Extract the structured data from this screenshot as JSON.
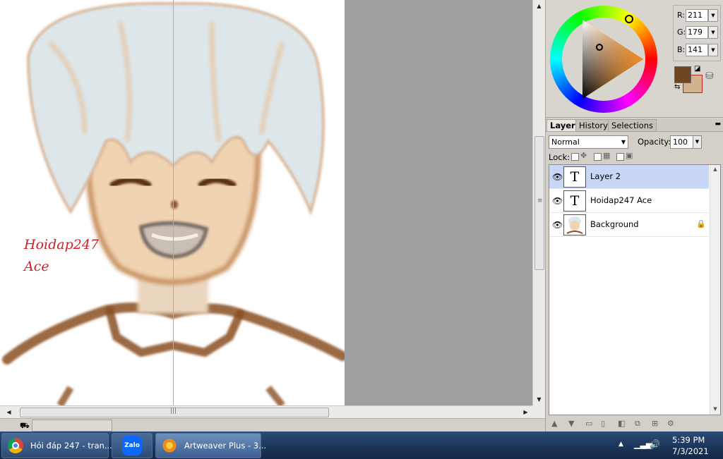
{
  "canvas": {
    "signature_line1": "Hoidap247",
    "signature_line2": "Ace"
  },
  "scrollbars": {
    "vertical_grip": "≡",
    "horizontal_grip": "|||"
  },
  "color_panel": {
    "r_label": "R:",
    "r_value": "211",
    "g_label": "G:",
    "g_value": "179",
    "b_label": "B:",
    "b_value": "141",
    "foreground_color": "#6e4622",
    "background_color": "#d3b38d"
  },
  "tabs": [
    {
      "label": "Layers",
      "active": true
    },
    {
      "label": "History",
      "active": false
    },
    {
      "label": "Selections",
      "active": false
    }
  ],
  "layers_panel": {
    "blend_mode": "Normal",
    "opacity_label": "Opacity:",
    "opacity_value": "100",
    "lock_label": "Lock:",
    "layers": [
      {
        "name": "Layer 2",
        "thumb": "T",
        "selected": true
      },
      {
        "name": "Hoidap247 Ace",
        "thumb": "T",
        "selected": false
      },
      {
        "name": "Background",
        "thumb": "",
        "selected": false,
        "locked": true
      }
    ]
  },
  "taskbar": {
    "items": [
      {
        "label": "Hỏi đáp 247 - tran...",
        "icon": "chrome-icon"
      },
      {
        "label": "",
        "icon": "zalo-icon",
        "icon_text": "Zalo"
      },
      {
        "label": "Artweaver Plus - 3...",
        "icon": "artweaver-icon"
      }
    ],
    "clock_time": "5:39 PM",
    "clock_date": "7/3/2021"
  }
}
